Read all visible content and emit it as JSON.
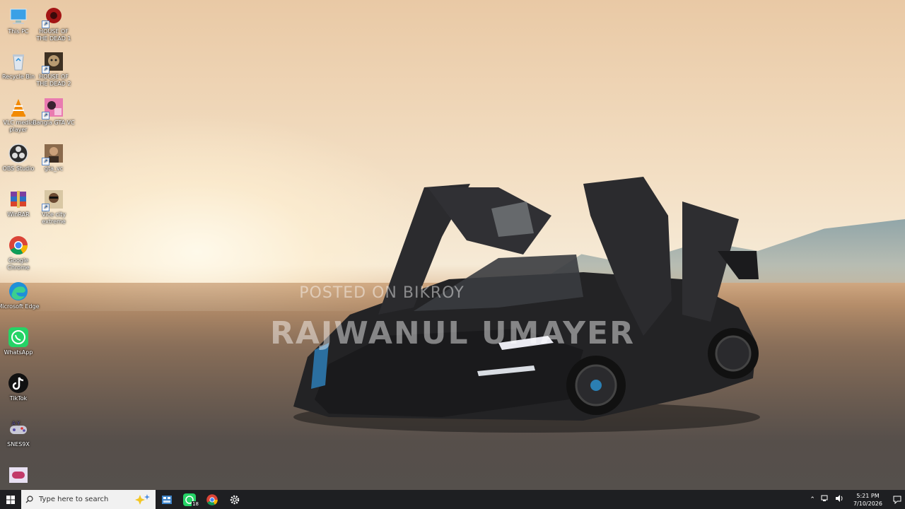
{
  "watermark": {
    "line1": "POSTED ON BIKROY",
    "line2": "RAJWANUL UMAYER"
  },
  "desktop_icons": [
    {
      "label": "This PC",
      "icon": "this-pc-icon"
    },
    {
      "label": "HOUSE OF THE DEAD 1",
      "icon": "house-of-the-dead-1-icon"
    },
    {
      "label": "Recycle Bin",
      "icon": "recycle-bin-icon"
    },
    {
      "label": "HOUSE OF THE DEAD 2",
      "icon": "house-of-the-dead-2-icon"
    },
    {
      "label": "VLC media player",
      "icon": "vlc-icon"
    },
    {
      "label": "Bangla GTA VC",
      "icon": "bangla-gta-vc-icon"
    },
    {
      "label": "OBS Studio",
      "icon": "obs-icon"
    },
    {
      "label": "gta_vc",
      "icon": "gta-vc-icon"
    },
    {
      "label": "WinRAR",
      "icon": "winrar-icon"
    },
    {
      "label": "Vice city extreme",
      "icon": "vice-city-extreme-icon"
    },
    {
      "label": "Google Chrome",
      "icon": "chrome-icon"
    },
    {
      "label": "Microsoft Edge",
      "icon": "edge-icon"
    },
    {
      "label": "WhatsApp",
      "icon": "whatsapp-icon"
    },
    {
      "label": "TikTok",
      "icon": "tiktok-icon"
    },
    {
      "label": "SNES9X",
      "icon": "snes9x-icon"
    }
  ],
  "taskbar": {
    "search_placeholder": "Type here to search",
    "whatsapp_badge": "18",
    "time": "5:21 PM",
    "date": "7/10/2026"
  },
  "colors": {
    "taskbar": "#1e1f22",
    "whatsapp": "#25d366",
    "chrome_red": "#db4437",
    "chrome_green": "#0f9d58",
    "chrome_yellow": "#f4b400",
    "chrome_blue": "#4285f4"
  }
}
